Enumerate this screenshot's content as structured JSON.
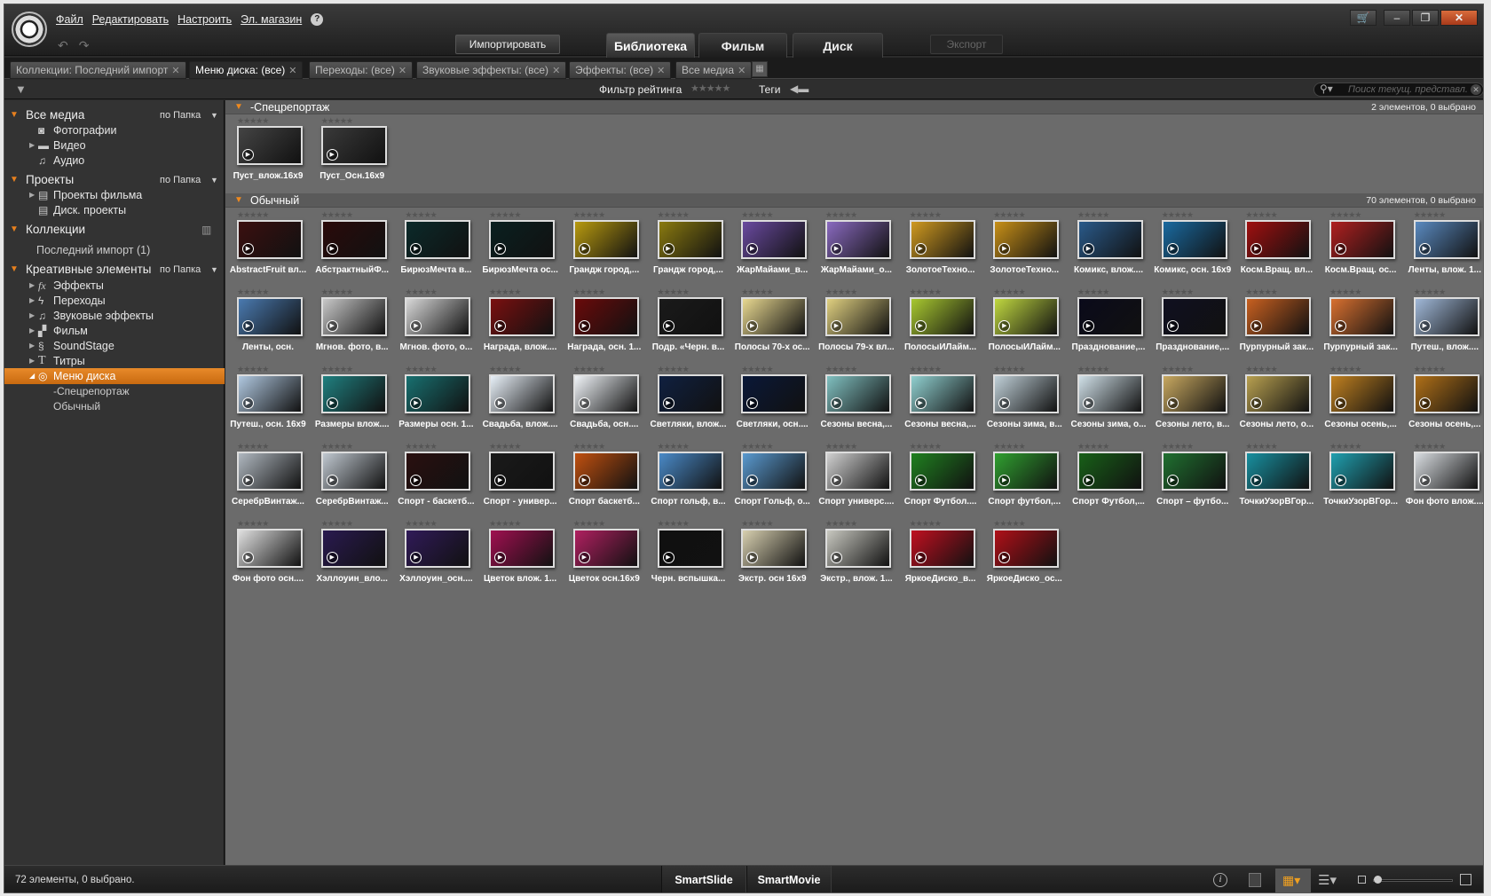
{
  "menu": {
    "items": [
      "Файл",
      "Редактировать",
      "Настроить",
      "Эл. магазин"
    ],
    "help": "?"
  },
  "toolbar": {
    "import_label": "Импортировать",
    "tabs": [
      "Библиотека",
      "Фильм",
      "Диск"
    ],
    "export_label": "Экспорт"
  },
  "library_tabs": [
    {
      "label": "Коллекции: Последний импорт",
      "active": false
    },
    {
      "label": "Меню диска: (все)",
      "active": true
    },
    {
      "label": "Переходы: (все)",
      "active": false
    },
    {
      "label": "Звуковые эффекты: (все)",
      "active": false
    },
    {
      "label": "Эффекты: (все)",
      "active": false
    },
    {
      "label": "Все медиа",
      "active": false
    }
  ],
  "filter": {
    "rating_label": "Фильтр рейтинга",
    "rating_stars": "★★★★★",
    "tags_label": "Теги",
    "search_placeholder": "Поиск текущ. представл."
  },
  "sidebar": {
    "all_media": "Все медиа",
    "sort_folder": "по Папка",
    "photos": "Фотографии",
    "video": "Видео",
    "audio": "Аудио",
    "projects": "Проекты",
    "film_projects": "Проекты фильма",
    "disc_projects": "Диск. проекты",
    "collections": "Коллекции",
    "last_import": "Последний импорт (1)",
    "creative": "Креативные элементы",
    "effects": "Эффекты",
    "transitions": "Переходы",
    "sound_effects": "Звуковые эффекты",
    "film": "Фильм",
    "soundstage": "SoundStage",
    "titles": "Титры",
    "disc_menu": "Меню диска",
    "special": "-Спецрепортаж",
    "normal": "Обычный"
  },
  "sections": [
    {
      "title": "-Спецрепортаж",
      "count": "2 элементов, 0 выбрано",
      "items": [
        {
          "label": "Пуст_влож.16x9",
          "color": "#444444"
        },
        {
          "label": "Пуст_Осн.16x9",
          "color": "#3a3a3a"
        }
      ]
    },
    {
      "title": "Обычный",
      "count": "70 элементов, 0 выбрано",
      "items": [
        {
          "label": "AbstractFruit вл...",
          "color": "#3b1010"
        },
        {
          "label": "АбстрактныйФ...",
          "color": "#2a0a0a"
        },
        {
          "label": "БирюзМечта в...",
          "color": "#0b2a2a"
        },
        {
          "label": "БирюзМечта ос...",
          "color": "#0a2020"
        },
        {
          "label": "Грандж город,...",
          "color": "#b89a10"
        },
        {
          "label": "Грандж город,...",
          "color": "#8a7a10"
        },
        {
          "label": "ЖарМайами_в...",
          "color": "#6a4aa0"
        },
        {
          "label": "ЖарМайами_о...",
          "color": "#8a6ac0"
        },
        {
          "label": "ЗолотоеТехно...",
          "color": "#d09a20"
        },
        {
          "label": "ЗолотоеТехно...",
          "color": "#c89018"
        },
        {
          "label": "Комикс, влож....",
          "color": "#2a5a8a"
        },
        {
          "label": "Комикс, осн. 16x9",
          "color": "#1a6aa0"
        },
        {
          "label": "Косм.Вращ. вл...",
          "color": "#a01010"
        },
        {
          "label": "Косм.Вращ. ос...",
          "color": "#b02020"
        },
        {
          "label": "Ленты, влож. 1...",
          "color": "#5a8ac0"
        },
        {
          "label": "Ленты, осн.",
          "color": "#4a7ab0"
        },
        {
          "label": "Мгнов. фото, в...",
          "color": "#c8c8c8"
        },
        {
          "label": "Мгнов. фото, о...",
          "color": "#d8d8d8"
        },
        {
          "label": "Награда, влож....",
          "color": "#7a1010"
        },
        {
          "label": "Награда, осн. 1...",
          "color": "#6a0a0a"
        },
        {
          "label": "Подр. «Черн. в...",
          "color": "#1a1a1a"
        },
        {
          "label": "Полосы 70-х ос...",
          "color": "#e8d890"
        },
        {
          "label": "Полосы 79-х вл...",
          "color": "#e0d080"
        },
        {
          "label": "ПолосыИЛайм...",
          "color": "#a8c830"
        },
        {
          "label": "ПолосыИЛайм...",
          "color": "#c0d840"
        },
        {
          "label": "Празднование,...",
          "color": "#0a0a1a"
        },
        {
          "label": "Празднование,...",
          "color": "#101020"
        },
        {
          "label": "Пурпурный зак...",
          "color": "#c86020"
        },
        {
          "label": "Пурпурный зак...",
          "color": "#d87030"
        },
        {
          "label": "Путеш., влож....",
          "color": "#a0b8d8"
        },
        {
          "label": "Путеш., осн. 16x9",
          "color": "#b0c8e0"
        },
        {
          "label": "Размеры влож....",
          "color": "#208080"
        },
        {
          "label": "Размеры осн. 1...",
          "color": "#187070"
        },
        {
          "label": "Свадьба, влож....",
          "color": "#e8f0f8"
        },
        {
          "label": "Свадьба, осн....",
          "color": "#f0f4f8"
        },
        {
          "label": "Светляки, влож...",
          "color": "#102040"
        },
        {
          "label": "Светляки, осн....",
          "color": "#0a1838"
        },
        {
          "label": "Сезоны весна,...",
          "color": "#80c0c0"
        },
        {
          "label": "Сезоны весна,...",
          "color": "#90d0d0"
        },
        {
          "label": "Сезоны зима, в...",
          "color": "#c0d0d8"
        },
        {
          "label": "Сезоны зима, о...",
          "color": "#d0e0e8"
        },
        {
          "label": "Сезоны лето, в...",
          "color": "#c8a860"
        },
        {
          "label": "Сезоны лето, о...",
          "color": "#b8a050"
        },
        {
          "label": "Сезоны осень,...",
          "color": "#c08020"
        },
        {
          "label": "Сезоны осень,...",
          "color": "#b07018"
        },
        {
          "label": "СеребрВинтаж...",
          "color": "#b0b8c0"
        },
        {
          "label": "СеребрВинтаж...",
          "color": "#c0c8d0"
        },
        {
          "label": "Спорт - баскетб...",
          "color": "#2a1010"
        },
        {
          "label": "Спорт - универ...",
          "color": "#1a1a1a"
        },
        {
          "label": "Спорт баскетб...",
          "color": "#c05010"
        },
        {
          "label": "Спорт гольф, в...",
          "color": "#4a8ac8"
        },
        {
          "label": "Спорт Гольф, о...",
          "color": "#5a9ad0"
        },
        {
          "label": "Спорт универс....",
          "color": "#d0d0d0"
        },
        {
          "label": "Спорт Футбол....",
          "color": "#208020"
        },
        {
          "label": "Спорт футбол,...",
          "color": "#30a030"
        },
        {
          "label": "Спорт Футбол,...",
          "color": "#186018"
        },
        {
          "label": "Спорт – футбо...",
          "color": "#207030"
        },
        {
          "label": "ТочкиУзорВГор...",
          "color": "#1890a0"
        },
        {
          "label": "ТочкиУзорВГор...",
          "color": "#20a0b0"
        },
        {
          "label": "Фон фото влож....",
          "color": "#d8dce0"
        },
        {
          "label": "Фон фото осн....",
          "color": "#e0e0e0"
        },
        {
          "label": "Хэллоуин_вло...",
          "color": "#2a1a50"
        },
        {
          "label": "Хэллоуин_осн....",
          "color": "#301a58"
        },
        {
          "label": "Цветок влож. 1...",
          "color": "#a01050"
        },
        {
          "label": "Цветок осн.16x9",
          "color": "#b02060"
        },
        {
          "label": "Черн. вспышка...",
          "color": "#101010"
        },
        {
          "label": "Экстр. осн 16x9",
          "color": "#d8d0b0"
        },
        {
          "label": "Экстр., влож. 1...",
          "color": "#c8c8c0"
        },
        {
          "label": "ЯркоеДиско_в...",
          "color": "#c01020"
        },
        {
          "label": "ЯркоеДиско_ос...",
          "color": "#b01018"
        }
      ]
    }
  ],
  "status": {
    "text": "72 элементы, 0 выбрано.",
    "smartslide": "SmartSlide",
    "smartmovie": "SmartMovie"
  },
  "accent_color": "#e8801e"
}
